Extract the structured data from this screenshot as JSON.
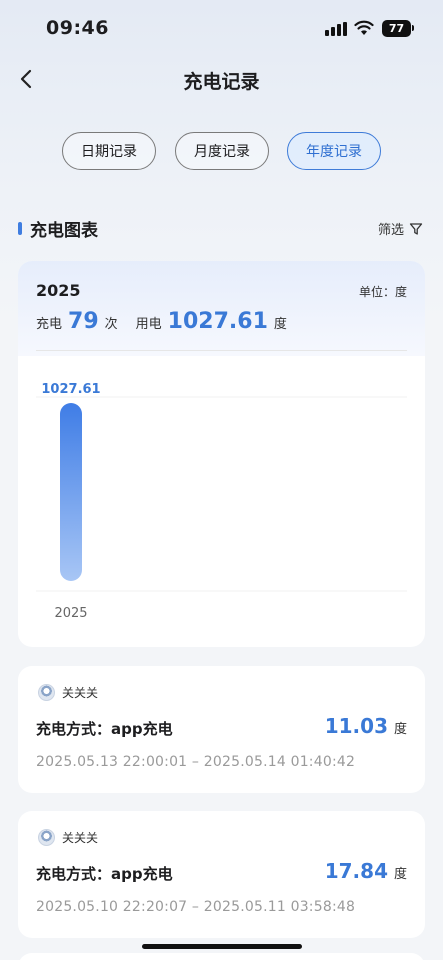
{
  "status_bar": {
    "time": "09:46",
    "battery": "77"
  },
  "nav": {
    "title": "充电记录"
  },
  "tabs": [
    {
      "label": "日期记录",
      "active": false
    },
    {
      "label": "月度记录",
      "active": false
    },
    {
      "label": "年度记录",
      "active": true
    }
  ],
  "section": {
    "title": "充电图表",
    "filter_label": "筛选"
  },
  "summary": {
    "year": "2025",
    "unit_label": "单位：度",
    "count_label": "充电",
    "count_value": "79",
    "count_unit": "次",
    "energy_label": "用电",
    "energy_value": "1027.61",
    "energy_unit": "度"
  },
  "chart_data": {
    "type": "bar",
    "categories": [
      "2025"
    ],
    "values": [
      1027.61
    ],
    "data_labels": [
      "1027.61"
    ],
    "ylim": [
      0,
      1027.61
    ],
    "grid": true,
    "colors": {
      "bar_top": "#3f7de6",
      "bar_bottom": "#a8c6f5",
      "label": "#3a79d6"
    }
  },
  "records": [
    {
      "user": "关关关",
      "method": "充电方式：app充电",
      "amount": "11.03",
      "unit": "度",
      "time_range": "2025.05.13 22:00:01 – 2025.05.14 01:40:42"
    },
    {
      "user": "关关关",
      "method": "充电方式：app充电",
      "amount": "17.84",
      "unit": "度",
      "time_range": "2025.05.10 22:20:07 – 2025.05.11 03:58:48"
    }
  ],
  "icons": {
    "back": "chevron-left-icon",
    "filter": "funnel-icon",
    "wifi": "wifi-icon",
    "signal": "cellular-signal-icon",
    "avatar": "user-avatar-icon"
  },
  "colors": {
    "accent": "#3a79d6",
    "active_tab_border": "#3e7bd8"
  }
}
